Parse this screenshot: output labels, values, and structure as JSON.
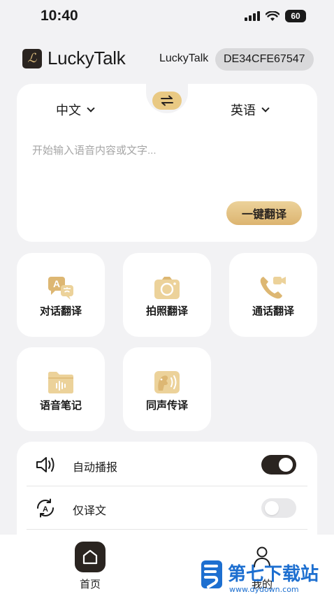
{
  "status_bar": {
    "time": "10:40",
    "battery": "60"
  },
  "header": {
    "logo_text": "LuckyTalk",
    "device_label": "LuckyTalk",
    "device_id": "DE34CFE67547"
  },
  "translate": {
    "source_lang": "中文",
    "target_lang": "英语",
    "placeholder": "开始输入语音内容或文字...",
    "translate_button": "一键翻译"
  },
  "features": [
    {
      "label": "对话翻译",
      "icon": "conversation-translate-icon"
    },
    {
      "label": "拍照翻译",
      "icon": "camera-icon"
    },
    {
      "label": "通话翻译",
      "icon": "phone-video-icon"
    },
    {
      "label": "语音笔记",
      "icon": "voice-note-folder-icon"
    },
    {
      "label": "同声传译",
      "icon": "simultaneous-interpretation-icon"
    }
  ],
  "settings": [
    {
      "label": "自动播报",
      "icon": "speaker-icon",
      "enabled": true
    },
    {
      "label": "仅译文",
      "icon": "translation-only-icon",
      "enabled": false
    }
  ],
  "tab_bar": {
    "home_label": "首页",
    "mine_label": "我的"
  },
  "watermark": {
    "text": "第七下载站",
    "url": "www.dydown.com"
  },
  "colors": {
    "accent_gold": "#e9c983",
    "dark": "#2a2420",
    "background": "#f2f2f4"
  }
}
